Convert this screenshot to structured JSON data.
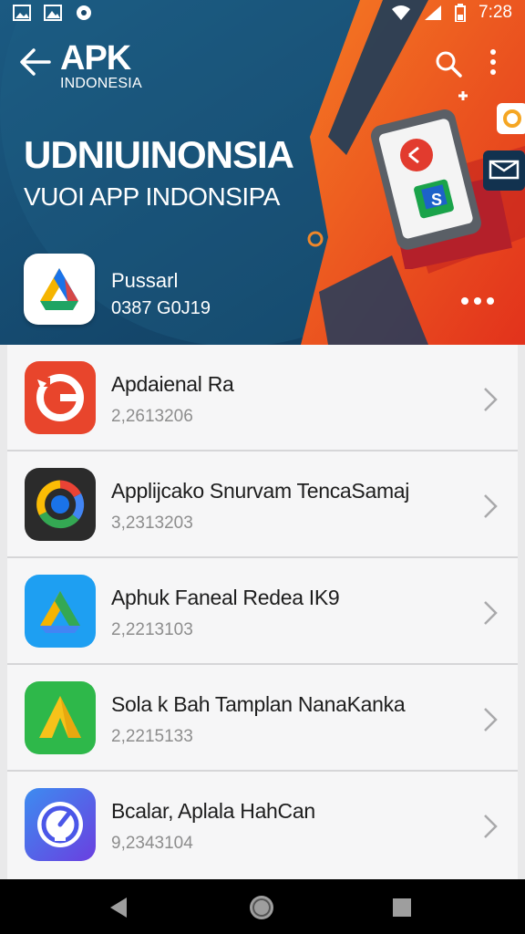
{
  "status_bar": {
    "left_icons": [
      "gallery-icon",
      "image-icon",
      "media-icon"
    ],
    "right_icons": [
      "wifi-icon",
      "signal-icon",
      "battery-icon"
    ],
    "time": "7:28"
  },
  "header": {
    "brand": "APK",
    "brand_sub": "INDONESIA",
    "title": "UDNIUINONSIA",
    "subtitle": "VUOI APP INDONSIPA",
    "featured": {
      "name": "Pussarl",
      "meta": "0387 G0J19"
    }
  },
  "apps": [
    {
      "name": "Apdaienal Ra",
      "meta": "2,2613206",
      "icon": "refresh-g-icon",
      "color": "#e8452c"
    },
    {
      "name": "Applijcako Snurvam TencaSamaj",
      "meta": "3,2313203",
      "icon": "google-g-icon",
      "color": "#2b2b2b"
    },
    {
      "name": "Aphuk Faneal Redea IK9",
      "meta": "2,2213103",
      "icon": "drive-icon",
      "color": "#1e9ff2"
    },
    {
      "name": "Sola k Bah Tamplan NanaKanka",
      "meta": "2,2215133",
      "icon": "a-triangle-icon",
      "color": "#2eb84a"
    },
    {
      "name": "Bcalar, Aplala HahCan",
      "meta": "9,2343104",
      "icon": "speedometer-icon",
      "color": "#4b57e8"
    }
  ],
  "colors": {
    "header_blue": "#16476a",
    "header_orange": "#f0541e",
    "list_bg": "#f6f6f7",
    "nav_bg": "#000000"
  },
  "nav_bar": [
    "back-icon",
    "home-icon",
    "recents-icon"
  ]
}
